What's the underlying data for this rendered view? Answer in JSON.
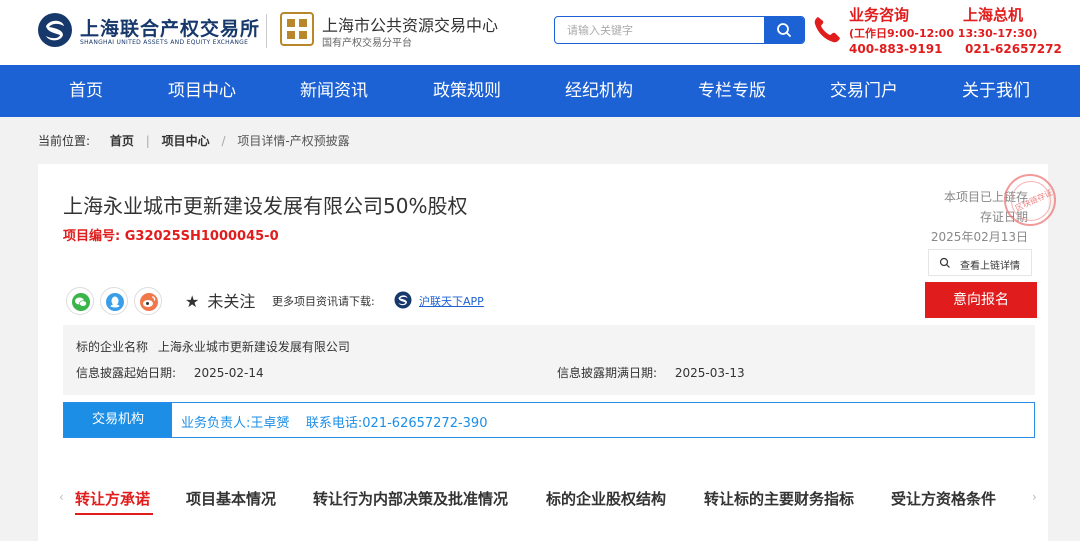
{
  "header": {
    "logo_name": "上海联合产权交易所",
    "logo_en": "SHANGHAI UNITED ASSETS AND EQUITY EXCHANGE",
    "center_name": "上海市公共资源交易中心",
    "center_sub": "国有产权交易分平台",
    "search_placeholder": "请输入关键字",
    "hotline": {
      "title1": "业务咨询",
      "title2": "上海总机",
      "hours": "(工作日9:00-12:00 13:30-17:30)",
      "number1": "400-883-9191",
      "number2": "021-62657272"
    }
  },
  "nav": [
    "首页",
    "项目中心",
    "新闻资讯",
    "政策规则",
    "经纪机构",
    "专栏专版",
    "交易门户",
    "关于我们"
  ],
  "breadcrumb": {
    "prefix": "当前位置:",
    "items": [
      "首页",
      "项目中心"
    ],
    "current": "项目详情-产权预披露"
  },
  "project": {
    "title": "上海永业城市更新建设发展有限公司50%股权",
    "code": "项目编号:  G32025SH1000045-0",
    "chain_line1": "本项目已上链存",
    "chain_line2": "存证日期",
    "chain_date": "2025年02月13日",
    "stamp_text": "区块链存证",
    "view_chain": "查看上链详情",
    "follow": "未关注",
    "download_text": "更多项目资讯请下载:",
    "app_name": "沪联天下APP",
    "apply": "意向报名"
  },
  "info": {
    "company_label": "标的企业名称",
    "company_value": "上海永业城市更新建设发展有限公司",
    "start_label": "信息披露起始日期:",
    "start_value": "2025-02-14",
    "end_label": "信息披露期满日期:",
    "end_value": "2025-03-13"
  },
  "agency": {
    "label": "交易机构",
    "text": "业务负责人:王卓赟    联系电话:021-62657272-390"
  },
  "tabs": [
    "转让方承诺",
    "项目基本情况",
    "转让行为内部决策及批准情况",
    "标的企业股权结构",
    "转让标的主要财务指标",
    "受让方资格条件"
  ],
  "colors": {
    "brand_blue": "#1d62d4",
    "accent_red": "#e01c1c",
    "agency_blue": "#1d8ee6"
  }
}
